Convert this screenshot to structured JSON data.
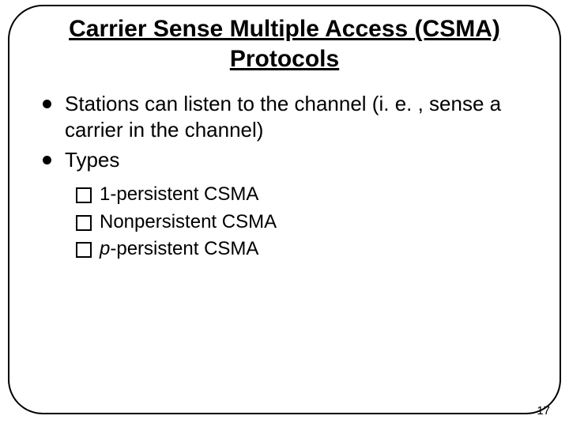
{
  "slide": {
    "title": "Carrier Sense Multiple Access (CSMA) Protocols",
    "bullets": [
      "Stations can listen to the channel (i. e. , sense a carrier in the channel)",
      "Types"
    ],
    "sub_items": [
      {
        "prefix": "",
        "italic": "",
        "suffix": "1-persistent CSMA"
      },
      {
        "prefix": "",
        "italic": "",
        "suffix": "Nonpersistent CSMA"
      },
      {
        "prefix": "",
        "italic": "p",
        "suffix": "-persistent CSMA"
      }
    ],
    "page_number": "17"
  }
}
